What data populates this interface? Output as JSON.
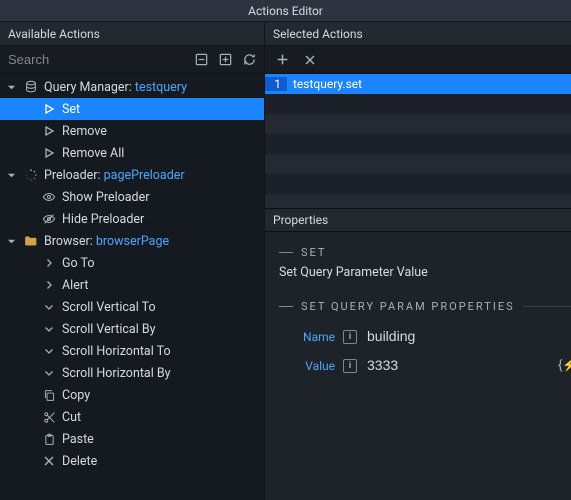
{
  "titlebar": "Actions Editor",
  "left": {
    "header": "Available Actions",
    "search_placeholder": "Search",
    "group_query_prefix": "Query Manager: ",
    "group_query_name": "testquery",
    "query_items": [
      "Set",
      "Remove",
      "Remove All"
    ],
    "group_preloader_prefix": "Preloader: ",
    "group_preloader_name": "pagePreloader",
    "preloader_items": [
      "Show Preloader",
      "Hide Preloader"
    ],
    "group_browser_prefix": "Browser: ",
    "group_browser_name": "browserPage",
    "browser_items": [
      "Go To",
      "Alert",
      "Scroll Vertical To",
      "Scroll Vertical By",
      "Scroll Horizontal To",
      "Scroll Horizontal By",
      "Copy",
      "Cut",
      "Paste",
      "Delete"
    ]
  },
  "right": {
    "header": "Selected Actions",
    "sel_row_num": "1",
    "sel_row_text": "testquery.set",
    "props_header": "Properties",
    "section1_title": "SET",
    "section1_desc": "Set Query Parameter Value",
    "section2_title": "SET QUERY PARAM PROPERTIES",
    "name_label": "Name",
    "name_value": "building",
    "value_label": "Value",
    "value_value": "3333"
  }
}
